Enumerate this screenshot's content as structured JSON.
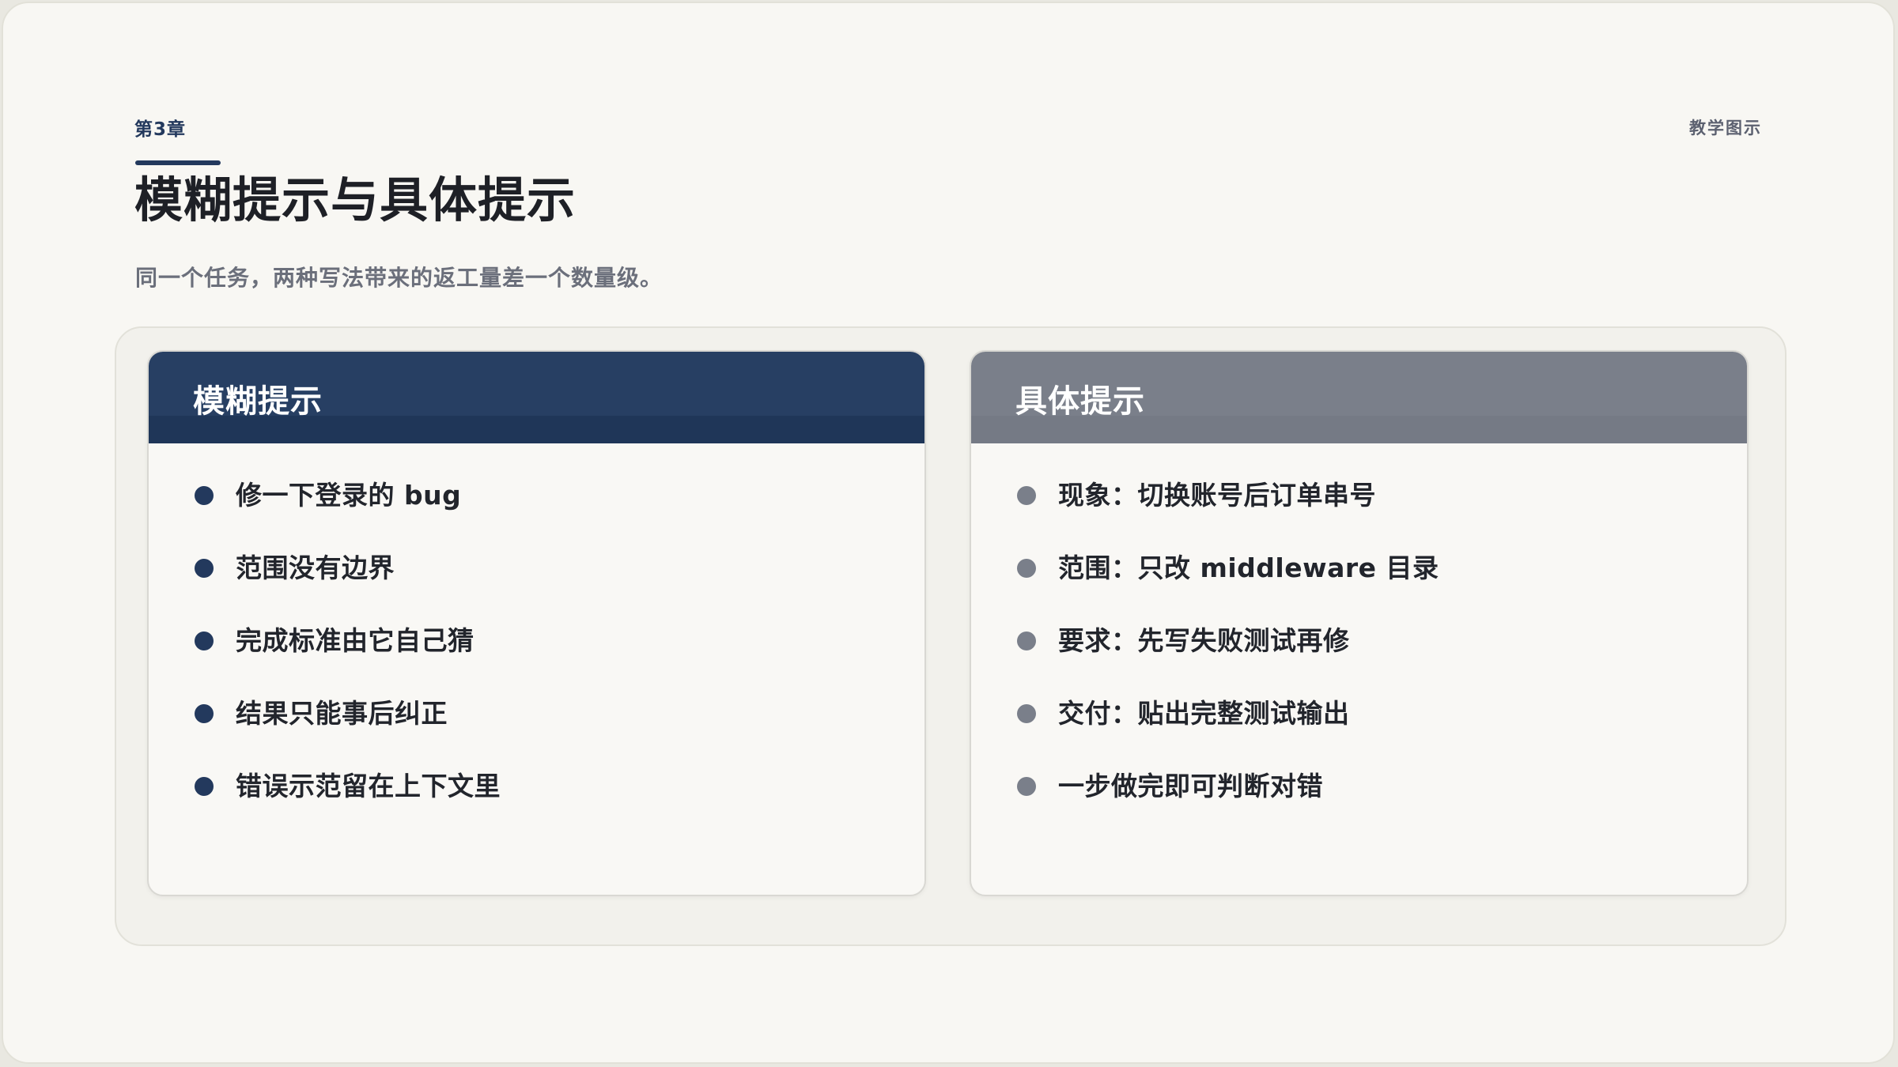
{
  "header": {
    "chapter": "第3章",
    "category": "教学图示",
    "title": "模糊提示与具体提示",
    "subtitle": "同一个任务，两种写法带来的返工量差一个数量级。"
  },
  "cards": [
    {
      "title": "模糊提示",
      "items": [
        "修一下登录的 bug",
        "范围没有边界",
        "完成标准由它自己猜",
        "结果只能事后纠正",
        "错误示范留在上下文里"
      ]
    },
    {
      "title": "具体提示",
      "items": [
        "现象：切换账号后订单串号",
        "范围：只改 middleware 目录",
        "要求：先写失败测试再修",
        "交付：贴出完整测试输出",
        "一步做完即可判断对错"
      ]
    }
  ],
  "colors": {
    "accent": "#23395d",
    "muted": "#7a7f8a",
    "background": "#f8f7f3"
  }
}
